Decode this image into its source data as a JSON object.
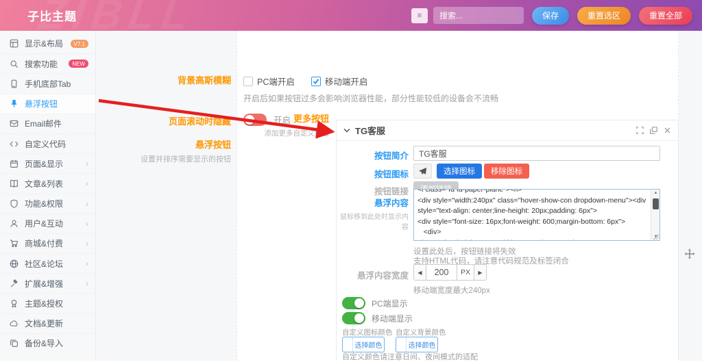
{
  "header": {
    "title": "子比主题",
    "watermark": "ZIBLL",
    "search_placeholder": "搜索...",
    "save_button": "保存",
    "reset_section_button": "重置选区",
    "reset_all_button": "重置全部",
    "hotkey_icon": "≡"
  },
  "sidebar": {
    "items": [
      {
        "label": "显示&布局",
        "icon": "layout-icon",
        "badge": "V7.1"
      },
      {
        "label": "搜索功能",
        "icon": "search-icon",
        "badge": "NEW"
      },
      {
        "label": "手机底部Tab",
        "icon": "phone-icon"
      },
      {
        "label": "悬浮按钮",
        "icon": "pin-icon",
        "active": true
      },
      {
        "label": "Email邮件",
        "icon": "mail-icon"
      },
      {
        "label": "自定义代码",
        "icon": "code-icon"
      },
      {
        "label": "页面&显示",
        "icon": "page-icon",
        "expandable": true
      },
      {
        "label": "文章&列表",
        "icon": "article-icon",
        "expandable": true
      },
      {
        "label": "功能&权限",
        "icon": "shield-icon",
        "expandable": true
      },
      {
        "label": "用户&互动",
        "icon": "user-icon",
        "expandable": true
      },
      {
        "label": "商城&付费",
        "icon": "cart-icon",
        "expandable": true
      },
      {
        "label": "社区&论坛",
        "icon": "community-icon",
        "expandable": true
      },
      {
        "label": "扩展&增强",
        "icon": "tools-icon",
        "expandable": true
      },
      {
        "label": "主题&授权",
        "icon": "award-icon"
      },
      {
        "label": "文档&更新",
        "icon": "cloud-icon"
      },
      {
        "label": "备份&导入",
        "icon": "copy-icon"
      }
    ],
    "chevron": "›"
  },
  "settings": {
    "gaussian_blur": {
      "label": "背景高斯模糊",
      "pc_checkbox": "PC端开启",
      "mobile_checkbox": "移动端开启",
      "hint": "开启后如果按钮过多会影响浏览器性能，部分性能较低的设备会不流畅"
    },
    "hide_on_scroll": {
      "label": "页面滚动时隐藏",
      "toggle_text": "开启"
    },
    "float_button": {
      "label": "悬浮按钮",
      "desc": "设置并排序需要显示的按钮"
    },
    "more_buttons": {
      "label": "更多按钮",
      "desc": "添加更多自定义按钮"
    }
  },
  "panel": {
    "title": "TG客服",
    "intro_label": "按钮简介",
    "intro_value": "TG客服",
    "icon_label": "按钮图标",
    "select_icon_button": "选择图标",
    "remove_icon_button": "移除图标",
    "link_label": "按钮链接",
    "add_link_button": "添加链接",
    "hover_label": "悬浮内容",
    "hover_desc": "鼠标移到此处时显示内容",
    "hover_code": "<i class=\"fa fa-paper-plane\"></i>\n<div style=\"width:240px\" class=\"hover-show-con dropdown-menu\"><div style=\"text-align: center;line-height: 20px;padding: 6px\">\n<div style=\"font-size: 16px;font-weight: 600;margin-bottom: 6px\">\n   <div>\n<img style=\"height: 18px;width: 18px\" data-src=\"/wp-",
    "hover_hint1": "设置此处后，按钮链接将失效",
    "hover_hint2": "支持HTML代码，请注意代码规范及标签闭合",
    "width_label": "悬浮内容宽度",
    "width_value": "200",
    "width_unit": "PX",
    "width_hint": "移动端宽度最大240px",
    "pc_show_toggle": "PC端显示",
    "mobile_show_toggle": "移动端显示",
    "icon_color_label": "自定义图标颜色",
    "bg_color_label": "自定义背景颜色",
    "pick_color_button": "选择颜色",
    "color_hint": "自定义颜色请注意日间、夜间模式的适配"
  },
  "colors": {
    "header_gradient_start": "#f0809b",
    "header_gradient_end": "#8d4bae",
    "accent_blue": "#2b9af3",
    "label_orange": "#ff9800",
    "save_blue": "#3a8ce8",
    "reset_orange": "#ee8526",
    "reset_red": "#ea3e55",
    "toggle_green": "#42b243",
    "toggle_red": "#ee6e6a",
    "remove_red": "#f4604f",
    "select_blue": "#2577e3"
  }
}
